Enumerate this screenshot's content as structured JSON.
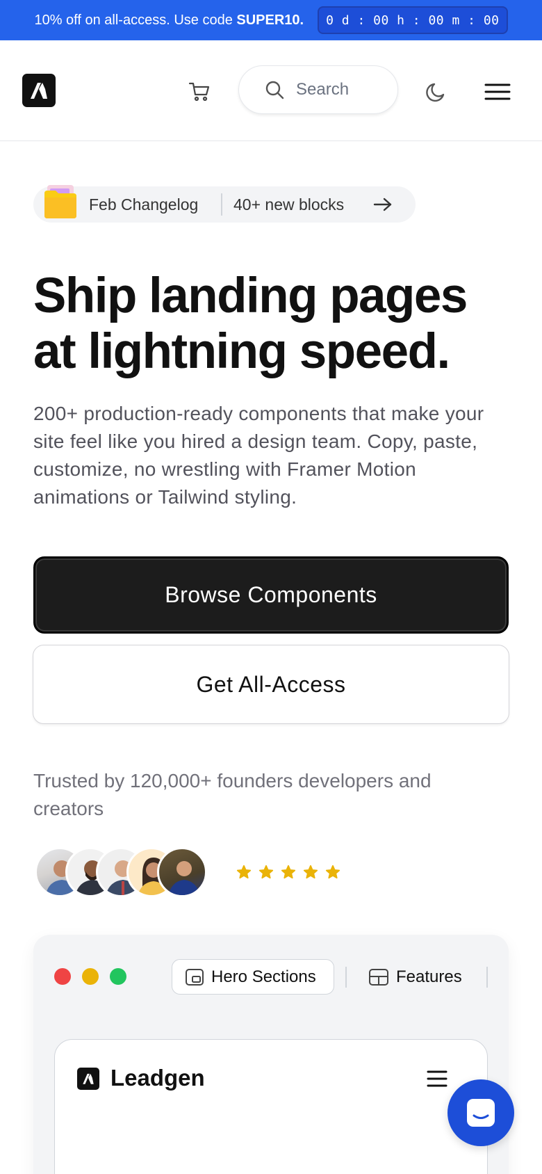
{
  "promo": {
    "text_prefix": "10% off on all-access. Use code ",
    "code": "SUPER10.",
    "timer": "0 d : 00 h : 00 m : 00"
  },
  "header": {
    "logo_icon": "brand-logo-icon",
    "cart_icon": "shopping-cart-icon",
    "search_placeholder": "Search",
    "theme_icon": "moon-icon",
    "menu_icon": "hamburger-menu-icon"
  },
  "changelog": {
    "label": "Feb Changelog",
    "detail": "40+ new blocks",
    "icon": "folder-icon",
    "arrow_icon": "arrow-right-icon"
  },
  "hero": {
    "headline_line1": "Ship landing pages",
    "headline_line2": "at lightning speed.",
    "subtext": "200+ production-ready components that make your site feel like you hired a design team. Copy, paste, customize, no wrestling with Framer Motion animations or Tailwind styling."
  },
  "buttons": {
    "primary": "Browse Components",
    "secondary": "Get All-Access"
  },
  "trust": {
    "text": "Trusted by 120,000+ founders developers and creators",
    "rating_stars": 5,
    "star_color": "#eab308"
  },
  "preview": {
    "tabs": [
      {
        "label": "Hero Sections",
        "icon": "hero-section-icon",
        "active": true
      },
      {
        "label": "Features",
        "icon": "features-layout-icon",
        "active": false
      }
    ],
    "window_dots": [
      "#ef4444",
      "#eab308",
      "#22c55e"
    ],
    "inner_brand": "Leadgen"
  },
  "colors": {
    "accent": "#2563eb",
    "chat_bubble": "#1d4ed8"
  }
}
